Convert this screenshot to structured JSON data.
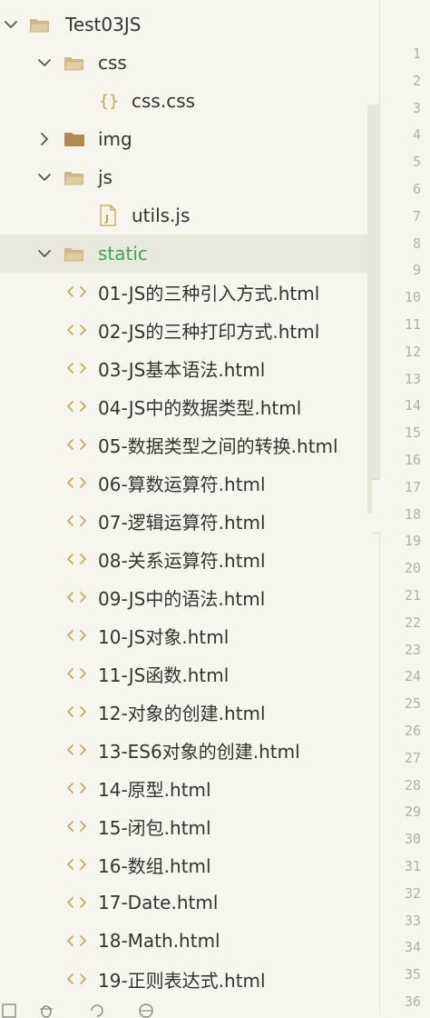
{
  "tree": {
    "items": [
      {
        "label": "Test03JS",
        "type": "folder",
        "expanded": true,
        "level": 0,
        "icon": "folder-open-icon",
        "name": "tree-folder-test03js"
      },
      {
        "label": "css",
        "type": "folder",
        "expanded": true,
        "level": 1,
        "icon": "folder-open-icon",
        "name": "tree-folder-css"
      },
      {
        "label": "css.css",
        "type": "css-file",
        "level": 2,
        "icon": "css-file-icon",
        "name": "tree-file-css-css"
      },
      {
        "label": "img",
        "type": "folder",
        "expanded": false,
        "level": 1,
        "icon": "folder-closed-icon",
        "name": "tree-folder-img"
      },
      {
        "label": "js",
        "type": "folder",
        "expanded": true,
        "level": 1,
        "icon": "folder-open-icon",
        "name": "tree-folder-js"
      },
      {
        "label": "utils.js",
        "type": "js-file",
        "level": 2,
        "icon": "js-file-icon",
        "name": "tree-file-utils-js"
      },
      {
        "label": "static",
        "type": "folder",
        "expanded": true,
        "level": 1,
        "icon": "folder-open-icon",
        "name": "tree-folder-static",
        "selected": true
      },
      {
        "label": "01-JS的三种引入方式.html",
        "type": "html-file",
        "level": 2,
        "icon": "html-file-icon",
        "name": "tree-file-01"
      },
      {
        "label": "02-JS的三种打印方式.html",
        "type": "html-file",
        "level": 2,
        "icon": "html-file-icon",
        "name": "tree-file-02"
      },
      {
        "label": "03-JS基本语法.html",
        "type": "html-file",
        "level": 2,
        "icon": "html-file-icon",
        "name": "tree-file-03"
      },
      {
        "label": "04-JS中的数据类型.html",
        "type": "html-file",
        "level": 2,
        "icon": "html-file-icon",
        "name": "tree-file-04"
      },
      {
        "label": "05-数据类型之间的转换.html",
        "type": "html-file",
        "level": 2,
        "icon": "html-file-icon",
        "name": "tree-file-05"
      },
      {
        "label": "06-算数运算符.html",
        "type": "html-file",
        "level": 2,
        "icon": "html-file-icon",
        "name": "tree-file-06"
      },
      {
        "label": "07-逻辑运算符.html",
        "type": "html-file",
        "level": 2,
        "icon": "html-file-icon",
        "name": "tree-file-07"
      },
      {
        "label": "08-关系运算符.html",
        "type": "html-file",
        "level": 2,
        "icon": "html-file-icon",
        "name": "tree-file-08"
      },
      {
        "label": "09-JS中的语法.html",
        "type": "html-file",
        "level": 2,
        "icon": "html-file-icon",
        "name": "tree-file-09"
      },
      {
        "label": "10-JS对象.html",
        "type": "html-file",
        "level": 2,
        "icon": "html-file-icon",
        "name": "tree-file-10"
      },
      {
        "label": "11-JS函数.html",
        "type": "html-file",
        "level": 2,
        "icon": "html-file-icon",
        "name": "tree-file-11"
      },
      {
        "label": "12-对象的创建.html",
        "type": "html-file",
        "level": 2,
        "icon": "html-file-icon",
        "name": "tree-file-12"
      },
      {
        "label": "13-ES6对象的创建.html",
        "type": "html-file",
        "level": 2,
        "icon": "html-file-icon",
        "name": "tree-file-13"
      },
      {
        "label": "14-原型.html",
        "type": "html-file",
        "level": 2,
        "icon": "html-file-icon",
        "name": "tree-file-14"
      },
      {
        "label": "15-闭包.html",
        "type": "html-file",
        "level": 2,
        "icon": "html-file-icon",
        "name": "tree-file-15"
      },
      {
        "label": "16-数组.html",
        "type": "html-file",
        "level": 2,
        "icon": "html-file-icon",
        "name": "tree-file-16"
      },
      {
        "label": "17-Date.html",
        "type": "html-file",
        "level": 2,
        "icon": "html-file-icon",
        "name": "tree-file-17"
      },
      {
        "label": "18-Math.html",
        "type": "html-file",
        "level": 2,
        "icon": "html-file-icon",
        "name": "tree-file-18"
      },
      {
        "label": "19-正则表达式.html",
        "type": "html-file",
        "level": 2,
        "icon": "html-file-icon",
        "name": "tree-file-19"
      }
    ]
  },
  "editor": {
    "tab_peek": "20",
    "line_numbers": [
      "1",
      "2",
      "3",
      "4",
      "5",
      "6",
      "7",
      "8",
      "9",
      "10",
      "11",
      "12",
      "13",
      "14",
      "15",
      "16",
      "17",
      "18",
      "19",
      "20",
      "21",
      "22",
      "23",
      "24",
      "25",
      "26",
      "27",
      "28",
      "29",
      "30",
      "31",
      "32",
      "33",
      "34",
      "35",
      "36"
    ]
  },
  "colors": {
    "background": "#f6f6ef",
    "selected_row": "#e9e8dc",
    "selected_text": "#3aa65a",
    "folder_icon": "#cdb887",
    "file_icon_outline": "#c9a54a",
    "line_number": "#b1b1a6"
  },
  "toolbar": {
    "icons": [
      "terminal-icon",
      "debug-bug-icon",
      "sync-icon",
      "browser-globe-icon"
    ]
  }
}
